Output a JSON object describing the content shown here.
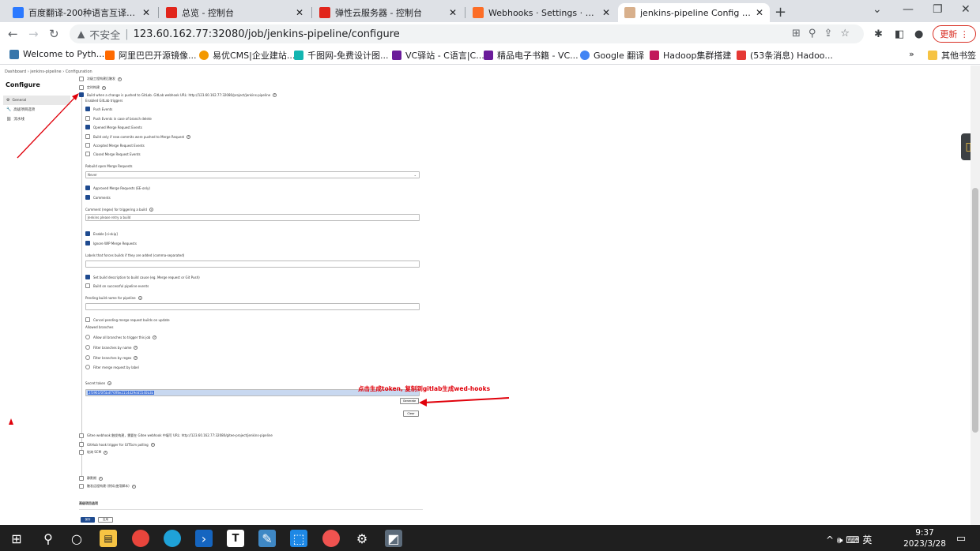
{
  "browser": {
    "tabs": [
      {
        "label": "百度翻译-200种语言互译、沟通",
        "color": "#2b79ff",
        "active": false
      },
      {
        "label": "总览 - 控制台",
        "color": "#e1251b",
        "active": false
      },
      {
        "label": "弹性云服务器 - 控制台",
        "color": "#e1251b",
        "active": false
      },
      {
        "label": "Webhooks · Settings · Adminis",
        "color": "#fc6d26",
        "active": false
      },
      {
        "label": "jenkins-pipeline Config [Jenkin",
        "color": "#d8b08c",
        "active": true
      }
    ],
    "insecure_label": "不安全",
    "url": "123.60.162.77:32080/job/jenkins-pipeline/configure",
    "update_label": "更新",
    "bookmarks": [
      {
        "label": "Welcome to Pyth...",
        "color": "#3776ab"
      },
      {
        "label": "阿里巴巴开源镜像...",
        "color": "#ff6a00"
      },
      {
        "label": "易优CMS|企业建站...",
        "color": "#f39800"
      },
      {
        "label": "千图网-免费设计图...",
        "color": "#13b5b1"
      },
      {
        "label": "VC驿站 - C语言|C...",
        "color": "#6a1b9a"
      },
      {
        "label": "精品电子书籍 - VC...",
        "color": "#6a1b9a"
      },
      {
        "label": "Google 翻译",
        "color": "#4285f4"
      },
      {
        "label": "Hadoop集群搭建",
        "color": "#c2185b"
      },
      {
        "label": "(53条消息) Hadoo...",
        "color": "#e53935"
      }
    ],
    "other_bookmarks": "其他书签"
  },
  "jenkins": {
    "breadcrumb": "Dashboard  ›  jenkins-pipeline  ›  Configuration",
    "title": "Configure",
    "sidenav": [
      {
        "icon": "gear-icon",
        "glyph": "⚙",
        "label": "General"
      },
      {
        "icon": "wrench-icon",
        "glyph": "🔧",
        "label": "高级项目选项"
      },
      {
        "icon": "pipeline-icon",
        "glyph": "⛓",
        "label": "流水线"
      }
    ],
    "checkboxes_top": [
      {
        "label": "次级工程构建后触发",
        "checked": false
      },
      {
        "label": "定时构建",
        "checked": false
      },
      {
        "label": "Build when a change is pushed to GitLab. GitLab webhook URL: http://123.60.162.77:32080/project/jenkins-pipeline",
        "checked": true
      }
    ],
    "enabled_triggers_label": "Enabled GitLab triggers",
    "triggers": [
      {
        "label": "Push Events",
        "checked": true
      },
      {
        "label": "Push Events in case of branch delete",
        "checked": false
      },
      {
        "label": "Opened Merge Request Events",
        "checked": true
      },
      {
        "label": "Build only if new commits were pushed to Merge Request",
        "checked": false
      },
      {
        "label": "Accepted Merge Request Events",
        "checked": false
      },
      {
        "label": "Closed Merge Request Events",
        "checked": false
      }
    ],
    "rebuild_label": "Rebuild open Merge Requests",
    "rebuild_value": "Never",
    "approved_label": "Approved Merge Requests (EE-only)",
    "comments_label": "Comments",
    "comment_regex_label": "Comment (regex) for triggering a build",
    "comment_regex_value": "Jenkins please retry a build",
    "enable_ci_skip": "Enable [ci-skip]",
    "ignore_wip": "Ignore WIP Merge Requests",
    "labels_force_label": "Labels that forces builds if they are added (comma-separated)",
    "set_build_desc": "Set build description to build cause (eg. Merge request or Git Push)",
    "build_on_success": "Build on successful pipeline events",
    "pending_build_label": "Pending build name for pipeline",
    "cancel_pending": "Cancel pending merge request builds on update",
    "allowed_branches_label": "Allowed branches",
    "branch_options": [
      "Allow all branches to trigger this job",
      "Filter branches by name",
      "Filter branches by regex",
      "Filter merge request by label"
    ],
    "secret_token_label": "Secret token",
    "secret_token_value": "2f3961f0f5bdf76ff8e2114d29dd5540b3b",
    "generate_label": "Generate",
    "clear_label": "Clear",
    "checkboxes_bottom": [
      "Gitee webhook 触发构建，需要在 Gitee webhook 中填写 URL: http://123.60.162.77:32080/gitee-project/jenkins-pipeline",
      "GitHub hook trigger for GITScm polling",
      "轮询 SCM"
    ],
    "checkboxes_bottom2": [
      "静默期",
      "触发远程构建 (例如,使用脚本)"
    ],
    "advanced_label": "高级项目选项",
    "save_label": "保存",
    "apply_label": "应用"
  },
  "annotation": "点击生成token, 复制到gitlab生成wed-hooks",
  "taskbar": {
    "tray_text": "^ 🕪 ⌨ 英",
    "time": "9:37",
    "date": "2023/3/28"
  }
}
